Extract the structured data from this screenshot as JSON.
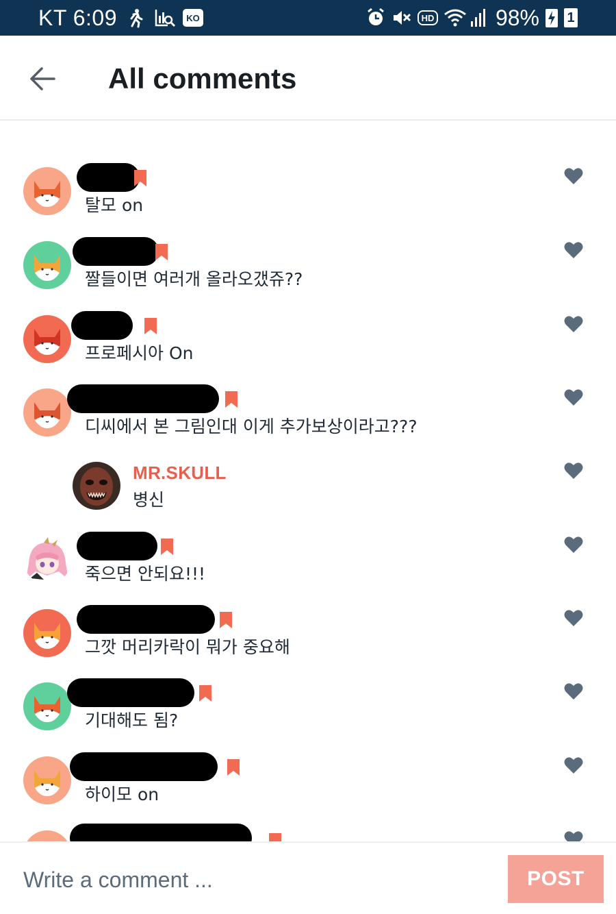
{
  "status_bar": {
    "carrier_time": "KT 6:09",
    "ime_badge": "KO",
    "hd_badge": "HD",
    "battery": "98%",
    "sim_slot": "1",
    "bg_color": "#0f3352"
  },
  "header": {
    "title": "All comments",
    "back_icon": "arrow-left-icon"
  },
  "comments": [
    {
      "name": "",
      "name_redacted": true,
      "text": "탈모 on",
      "avatar": "fox-icon",
      "avatar_bg": "#f9a587",
      "avatar_fox": "#e8632f"
    },
    {
      "name": "",
      "name_redacted": true,
      "text": "짤들이면 여러개 올라오갰쥬??",
      "avatar": "fox-icon",
      "avatar_bg": "#5fcf9b",
      "avatar_fox": "#f2a53a"
    },
    {
      "name": "",
      "name_redacted": true,
      "text": "프로페시아 On",
      "avatar": "fox-icon",
      "avatar_bg": "#f26a52",
      "avatar_fox": "#cf3425"
    },
    {
      "name": "",
      "name_redacted": true,
      "text": "디씨에서 본 그림인대 이게 추가보상이라고???",
      "avatar": "fox-icon",
      "avatar_bg": "#f9a587",
      "avatar_fox": "#dd5430"
    },
    {
      "name": "MR.SKULL",
      "name_redacted": false,
      "text": "병신",
      "avatar": "skull-avatar",
      "reply": true,
      "name_color": "#e8604c"
    },
    {
      "name": "",
      "name_redacted": true,
      "text": "죽으면 안되요!!!",
      "avatar": "anime-girl-avatar"
    },
    {
      "name": "",
      "name_redacted": true,
      "text": "그깟 머리카락이 뭐가 중요해",
      "avatar": "fox-icon",
      "avatar_bg": "#f26a52",
      "avatar_fox": "#f6a23a"
    },
    {
      "name": "",
      "name_redacted": true,
      "text": "기대해도 됨?",
      "avatar": "fox-icon",
      "avatar_bg": "#5fcf9b",
      "avatar_fox": "#e8632f"
    },
    {
      "name": "",
      "name_redacted": true,
      "text": "하이모 on",
      "avatar": "fox-icon",
      "avatar_bg": "#f9a587",
      "avatar_fox": "#f2a53a"
    }
  ],
  "composer": {
    "placeholder": "Write a comment ...",
    "post_label": "POST",
    "post_color": "#f5a396"
  },
  "colors": {
    "accent": "#e8604c",
    "like_icon": "#5a6b7c",
    "text": "#1f2a36"
  }
}
